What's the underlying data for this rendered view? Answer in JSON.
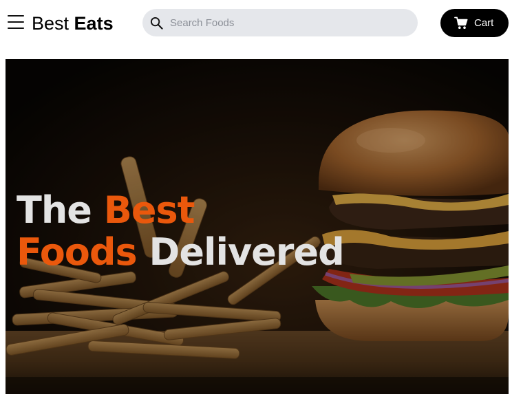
{
  "header": {
    "menu_icon": "hamburger-menu-icon",
    "logo": {
      "light": "Best",
      "bold": "Eats"
    },
    "search": {
      "placeholder": "Search Foods",
      "value": "",
      "icon": "search-icon"
    },
    "cart": {
      "label": "Cart",
      "icon": "cart-icon"
    }
  },
  "hero": {
    "line1": {
      "plain": "The",
      "accent": "Best"
    },
    "line2": {
      "accent": "Foods",
      "plain": "Delivered"
    },
    "colors": {
      "accent": "#ea580c",
      "text": "#e3e3e3"
    }
  }
}
